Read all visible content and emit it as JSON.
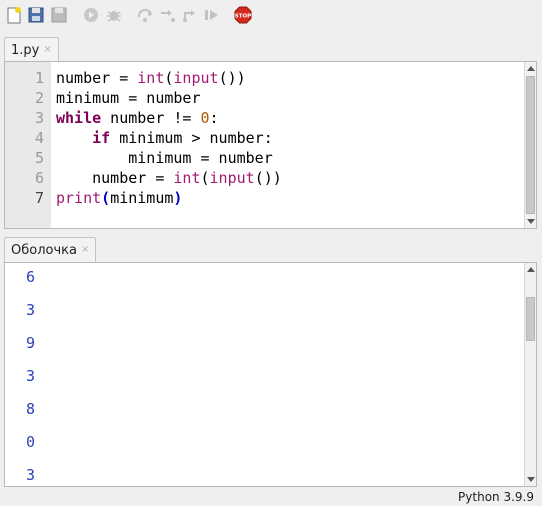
{
  "toolbar": {
    "buttons": [
      {
        "name": "new-file-icon",
        "enabled": true
      },
      {
        "name": "open-file-icon",
        "enabled": true
      },
      {
        "name": "save-file-icon",
        "enabled": false
      },
      {
        "name": "run-icon",
        "enabled": false
      },
      {
        "name": "debug-icon",
        "enabled": false
      },
      {
        "name": "step-over-icon",
        "enabled": false
      },
      {
        "name": "step-into-icon",
        "enabled": false
      },
      {
        "name": "step-out-icon",
        "enabled": false
      },
      {
        "name": "resume-icon",
        "enabled": false
      },
      {
        "name": "stop-icon",
        "enabled": true,
        "label": "STOP"
      }
    ]
  },
  "editor": {
    "tab_label": "1.py",
    "close_glyph": "×",
    "line_numbers": [
      "1",
      "2",
      "3",
      "4",
      "5",
      "6",
      "7"
    ],
    "current_line": "7",
    "code_lines": [
      "number = int(input())",
      "minimum = number",
      "while number != 0:",
      "    if minimum > number:",
      "        minimum = number",
      "    number = int(input())",
      "print(minimum)"
    ]
  },
  "shell": {
    "tab_label": "Оболочка",
    "close_glyph": "×",
    "output": [
      "6",
      "3",
      "9",
      "3",
      "8",
      "0",
      "3"
    ],
    "output_color": "#2a41b8"
  },
  "status": {
    "interpreter": "Python 3.9.9"
  },
  "colors": {
    "keyword": "#7f0055",
    "builtin": "#a21b70",
    "number": "#b45a00",
    "stop_red": "#d42a1c"
  }
}
